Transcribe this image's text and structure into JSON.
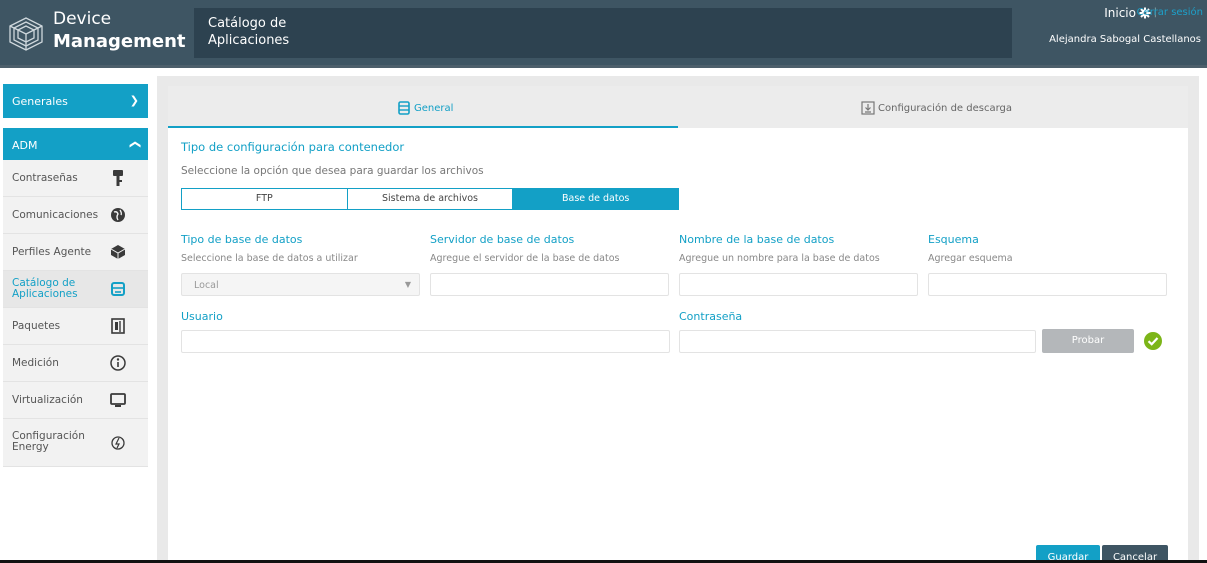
{
  "header": {
    "brand_line1": "Device",
    "brand_line2": "Management",
    "page_title_line1": "Catálogo de",
    "page_title_line2": "Aplicaciones",
    "inicio_label": "Inicio",
    "logout_label": "Cerrar sesión",
    "separator": "|",
    "user_name": "Alejandra Sabogal Castellanos"
  },
  "sidebar": {
    "generales": "Generales",
    "adm": "ADM",
    "generales_chevron": "˅",
    "adm_chevron": "˄",
    "items": [
      {
        "label": "Contraseñas",
        "icon": "key-icon"
      },
      {
        "label": "Comunicaciones",
        "icon": "globe-icon"
      },
      {
        "label": "Perfiles Agente",
        "icon": "cubes-icon"
      },
      {
        "label": "Catálogo de Aplicaciones",
        "label_line1": "Catálogo de",
        "label_line2": "Aplicaciones",
        "icon": "catalog-icon",
        "active": true
      },
      {
        "label": "Paquetes",
        "icon": "package-icon"
      },
      {
        "label": "Medición",
        "icon": "gauge-icon"
      },
      {
        "label": "Virtualización",
        "icon": "monitor-icon"
      },
      {
        "label": "Configuración Energy",
        "label_line1": "Configuración",
        "label_line2": "Energy",
        "icon": "energy-icon"
      }
    ]
  },
  "tabs": {
    "general": "General",
    "descarga": "Configuración de descarga"
  },
  "section": {
    "title": "Tipo de configuración para contenedor",
    "description": "Seleccione la opción que desea para guardar los archivos"
  },
  "storage_options": {
    "ftp": "FTP",
    "filesystem": "Sistema de archivos",
    "database": "Base de datos",
    "selected": "Base de datos"
  },
  "form": {
    "db_type_label": "Tipo de base de datos",
    "db_type_help": "Seleccione la base de datos a utilizar",
    "db_type_value": "Local",
    "db_type_arrow": "▼",
    "server_label": "Servidor de base de datos",
    "server_help": "Agregue el servidor de la base de datos",
    "server_value": "",
    "dbname_label": "Nombre de la base de datos",
    "dbname_help": "Agregue un nombre para la base de datos",
    "dbname_value": "",
    "schema_label": "Esquema",
    "schema_help": "Agregar esquema",
    "schema_value": "",
    "user_label": "Usuario",
    "user_value": "",
    "password_label": "Contraseña",
    "password_value": "",
    "test_button": "Probar"
  },
  "actions": {
    "save": "Guardar",
    "cancel": "Cancelar"
  },
  "colors": {
    "accent": "#13a0c6",
    "header": "#3e5563",
    "success": "#7cb518"
  }
}
